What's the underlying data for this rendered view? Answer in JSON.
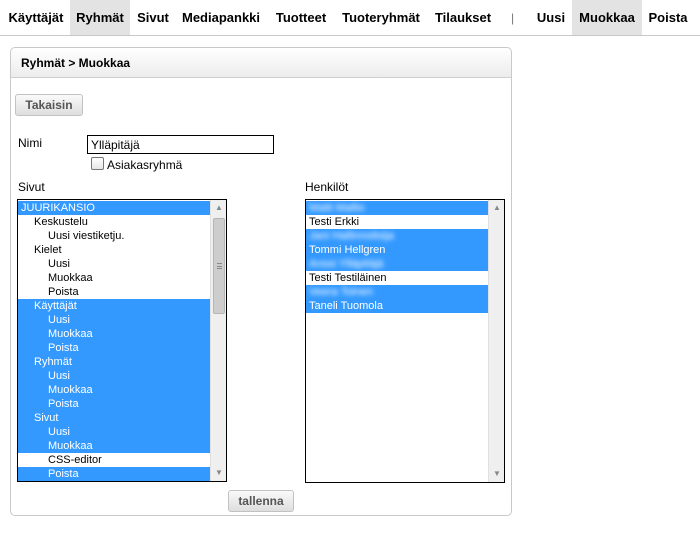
{
  "nav": {
    "items": [
      {
        "label": "Käyttäjät",
        "active": false
      },
      {
        "label": "Ryhmät",
        "active": true
      },
      {
        "label": "Sivut",
        "active": false
      },
      {
        "label": "Mediapankki",
        "active": false
      },
      {
        "label": "Tuotteet",
        "active": false
      },
      {
        "label": "Tuoteryhmät",
        "active": false
      },
      {
        "label": "Tilaukset",
        "active": false
      }
    ],
    "separator": "|",
    "actions": [
      {
        "label": "Uusi",
        "active": false
      },
      {
        "label": "Muokkaa",
        "active": true
      },
      {
        "label": "Poista",
        "active": false
      }
    ]
  },
  "panel": {
    "breadcrumb": "Ryhmät > Muokkaa",
    "back_label": "Takaisin",
    "name_label": "Nimi",
    "name_value": "Ylläpitäjä",
    "customer_group_label": "Asiakasryhmä",
    "customer_group_checked": false,
    "pages_label": "Sivut",
    "people_label": "Henkilöt",
    "save_label": "tallenna"
  },
  "pages": [
    {
      "text": "JUURIKANSIO",
      "level": 0,
      "selected": true
    },
    {
      "text": "Keskustelu",
      "level": 1,
      "selected": false
    },
    {
      "text": "Uusi viestiketju.",
      "level": 2,
      "selected": false
    },
    {
      "text": "Kielet",
      "level": 1,
      "selected": false
    },
    {
      "text": "Uusi",
      "level": 2,
      "selected": false
    },
    {
      "text": "Muokkaa",
      "level": 2,
      "selected": false
    },
    {
      "text": "Poista",
      "level": 2,
      "selected": false
    },
    {
      "text": "Käyttäjät",
      "level": 1,
      "selected": true
    },
    {
      "text": "Uusi",
      "level": 2,
      "selected": true
    },
    {
      "text": "Muokkaa",
      "level": 2,
      "selected": true
    },
    {
      "text": "Poista",
      "level": 2,
      "selected": true
    },
    {
      "text": "Ryhmät",
      "level": 1,
      "selected": true
    },
    {
      "text": "Uusi",
      "level": 2,
      "selected": true
    },
    {
      "text": "Muokkaa",
      "level": 2,
      "selected": true
    },
    {
      "text": "Poista",
      "level": 2,
      "selected": true
    },
    {
      "text": "Sivut",
      "level": 1,
      "selected": true
    },
    {
      "text": "Uusi",
      "level": 2,
      "selected": true
    },
    {
      "text": "Muokkaa",
      "level": 2,
      "selected": true
    },
    {
      "text": "CSS-editor",
      "level": 2,
      "selected": false
    },
    {
      "text": "Poista",
      "level": 2,
      "selected": true
    }
  ],
  "people": [
    {
      "text": "Matti Mallio",
      "selected": true,
      "blurred": true
    },
    {
      "text": "Testi Erkki",
      "selected": false,
      "blurred": false
    },
    {
      "text": "Jani Hallinnoitsija",
      "selected": true,
      "blurred": true
    },
    {
      "text": "Tommi Hellgren",
      "selected": true,
      "blurred": false
    },
    {
      "text": "Anssi Ylläpitäjä",
      "selected": true,
      "blurred": true
    },
    {
      "text": "Testi Testiläinen",
      "selected": false,
      "blurred": false
    },
    {
      "text": "Veera Toinen",
      "selected": true,
      "blurred": true
    },
    {
      "text": "Taneli Tuomola",
      "selected": true,
      "blurred": false
    }
  ],
  "colors": {
    "selection": "#3399ff",
    "active_tab": "#e3e3e3"
  }
}
